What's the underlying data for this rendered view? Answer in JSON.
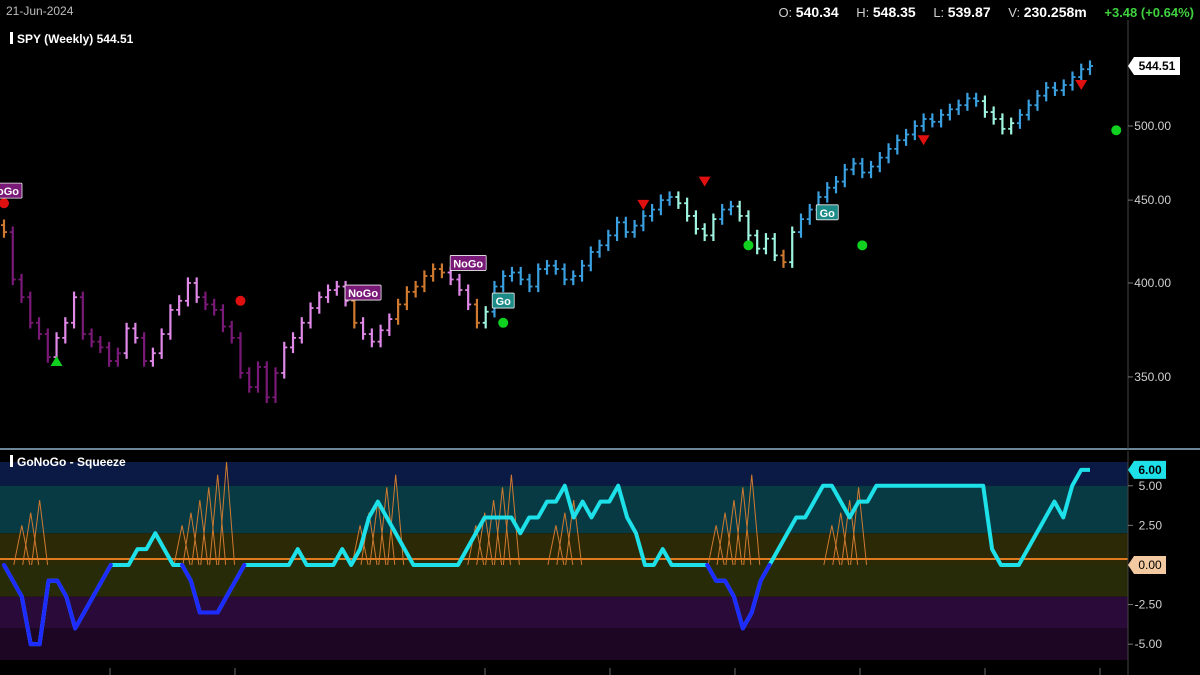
{
  "header": {
    "date": "21-Jun-2024",
    "open_label": "O:",
    "open": "540.34",
    "high_label": "H:",
    "high": "548.35",
    "low_label": "L:",
    "low": "539.87",
    "vol_label": "V:",
    "volume": "230.258m",
    "change": "+3.48 (+0.64%)"
  },
  "colors": {
    "background": "#000000",
    "go_strong": "#3aa0e0",
    "go_weak": "#9ff5e0",
    "nogo_strong": "#7a1a78",
    "nogo_weak": "#e089e8",
    "amber": "#d07a30",
    "oscillator_line": "#1de0e8",
    "squeeze_line": "#1e2bff",
    "zero_line": "#e07a20"
  },
  "chart_data": [
    {
      "type": "ohlc",
      "title": "SPY (Weekly) 544.51",
      "last_price_label": "544.51",
      "y_scale": "log",
      "ylim": [
        320,
        565
      ],
      "y_ticks": [
        "350.00",
        "400.00",
        "450.00",
        "500.00"
      ],
      "closes": [
        430,
        402,
        392,
        378,
        372,
        360,
        370,
        378,
        392,
        372,
        368,
        365,
        358,
        362,
        375,
        370,
        358,
        362,
        372,
        385,
        390,
        400,
        392,
        388,
        385,
        376,
        370,
        352,
        345,
        355,
        340,
        352,
        365,
        370,
        378,
        386,
        392,
        396,
        398,
        390,
        378,
        372,
        368,
        374,
        380,
        388,
        395,
        398,
        404,
        408,
        406,
        402,
        396,
        388,
        378,
        384,
        398,
        404,
        406,
        402,
        398,
        408,
        410,
        408,
        402,
        404,
        410,
        418,
        422,
        428,
        436,
        430,
        434,
        440,
        444,
        450,
        452,
        448,
        440,
        432,
        428,
        438,
        444,
        446,
        440,
        428,
        420,
        426,
        416,
        412,
        430,
        438,
        444,
        452,
        458,
        462,
        470,
        474,
        468,
        472,
        478,
        484,
        490,
        494,
        500,
        505,
        503,
        508,
        512,
        515,
        520,
        518,
        510,
        505,
        498,
        502,
        508,
        515,
        522,
        528,
        526,
        530,
        536,
        542,
        544.51
      ],
      "trend_colors": [
        "amber",
        "nogo_strong",
        "nogo_strong",
        "nogo_strong",
        "nogo_strong",
        "nogo_strong",
        "nogo_weak",
        "nogo_weak",
        "nogo_weak",
        "nogo_strong",
        "nogo_strong",
        "nogo_strong",
        "nogo_strong",
        "nogo_strong",
        "nogo_weak",
        "nogo_weak",
        "nogo_strong",
        "nogo_weak",
        "nogo_weak",
        "nogo_weak",
        "nogo_weak",
        "nogo_weak",
        "nogo_weak",
        "nogo_strong",
        "nogo_strong",
        "nogo_strong",
        "nogo_strong",
        "nogo_strong",
        "nogo_strong",
        "nogo_strong",
        "nogo_strong",
        "nogo_strong",
        "nogo_weak",
        "nogo_weak",
        "nogo_weak",
        "nogo_weak",
        "nogo_weak",
        "nogo_weak",
        "nogo_weak",
        "nogo_weak",
        "amber",
        "nogo_weak",
        "nogo_weak",
        "nogo_weak",
        "nogo_weak",
        "amber",
        "amber",
        "amber",
        "amber",
        "amber",
        "amber",
        "nogo_weak",
        "nogo_weak",
        "nogo_weak",
        "amber",
        "go_weak",
        "go_strong",
        "go_strong",
        "go_strong",
        "go_strong",
        "go_strong",
        "go_strong",
        "go_strong",
        "go_strong",
        "go_strong",
        "go_strong",
        "go_strong",
        "go_strong",
        "go_strong",
        "go_strong",
        "go_strong",
        "go_strong",
        "go_strong",
        "go_strong",
        "go_strong",
        "go_strong",
        "go_strong",
        "go_weak",
        "go_weak",
        "go_weak",
        "go_weak",
        "go_weak",
        "go_strong",
        "go_strong",
        "go_weak",
        "go_weak",
        "go_weak",
        "go_weak",
        "go_weak",
        "amber",
        "go_weak",
        "go_strong",
        "go_strong",
        "go_strong",
        "go_strong",
        "go_strong",
        "go_strong",
        "go_strong",
        "go_strong",
        "go_strong",
        "go_strong",
        "go_strong",
        "go_strong",
        "go_strong",
        "go_strong",
        "go_strong",
        "go_strong",
        "go_strong",
        "go_strong",
        "go_strong",
        "go_strong",
        "go_strong",
        "go_weak",
        "go_weak",
        "go_weak",
        "go_weak",
        "go_strong",
        "go_strong",
        "go_strong",
        "go_strong",
        "go_strong",
        "go_strong",
        "go_strong",
        "go_strong",
        "go_strong"
      ],
      "trend_labels": [
        {
          "bar": 0,
          "text": "NoGo",
          "kind": "nogo"
        },
        {
          "bar": 41,
          "text": "NoGo",
          "kind": "nogo"
        },
        {
          "bar": 53,
          "text": "NoGo",
          "kind": "nogo"
        },
        {
          "bar": 57,
          "text": "Go",
          "kind": "go"
        },
        {
          "bar": 94,
          "text": "Go",
          "kind": "go"
        }
      ],
      "markers": [
        {
          "bar": 0,
          "type": "dot",
          "color": "red",
          "value": 448
        },
        {
          "bar": 6,
          "type": "triangle-up",
          "color": "green",
          "value": 358
        },
        {
          "bar": 27,
          "type": "dot",
          "color": "red",
          "value": 390
        },
        {
          "bar": 57,
          "type": "dot",
          "color": "green",
          "value": 378
        },
        {
          "bar": 73,
          "type": "triangle-down",
          "color": "red",
          "value": 447
        },
        {
          "bar": 80,
          "type": "triangle-down",
          "color": "red",
          "value": 462
        },
        {
          "bar": 85,
          "type": "dot",
          "color": "green",
          "value": 422
        },
        {
          "bar": 98,
          "type": "dot",
          "color": "green",
          "value": 422
        },
        {
          "bar": 105,
          "type": "triangle-down",
          "color": "red",
          "value": 490
        },
        {
          "bar": 123,
          "type": "triangle-down",
          "color": "red",
          "value": 530
        },
        {
          "bar": 127,
          "type": "dot",
          "color": "green",
          "value": 497
        }
      ]
    },
    {
      "type": "line",
      "title": "GoNoGo - Squeeze",
      "value_label": "6.00",
      "zero_label": "0.00",
      "ylim": [
        -6,
        6.5
      ],
      "y_ticks": [
        "5.00",
        "2.50",
        "-2.50",
        "-5.00"
      ],
      "values": [
        0,
        -1,
        -2,
        -5,
        -5,
        -1,
        -1,
        -2,
        -4,
        -3,
        -2,
        -1,
        0,
        0,
        0,
        1,
        1,
        2,
        1,
        0,
        0,
        -1,
        -3,
        -3,
        -3,
        -2,
        -1,
        0,
        0,
        0,
        0,
        0,
        0,
        1,
        0,
        0,
        0,
        0,
        1,
        0,
        1,
        3,
        4,
        3,
        2,
        1,
        0,
        0,
        0,
        0,
        0,
        0,
        1,
        2,
        3,
        3,
        3,
        3,
        2,
        3,
        3,
        4,
        4,
        5,
        3,
        4,
        3,
        4,
        4,
        5,
        3,
        2,
        0,
        0,
        1,
        0,
        0,
        0,
        0,
        0,
        -1,
        -1,
        -2,
        -4,
        -3,
        -1,
        0,
        1,
        2,
        3,
        3,
        4,
        5,
        5,
        4,
        3,
        4,
        4,
        5,
        5,
        5,
        5,
        5,
        5,
        5,
        5,
        5,
        5,
        5,
        5,
        5,
        1,
        0,
        0,
        0,
        1,
        2,
        3,
        4,
        3,
        5,
        6,
        6
      ],
      "squeeze_sections": [
        [
          2,
          4
        ],
        [
          20,
          25
        ],
        [
          40,
          44
        ],
        [
          53,
          57
        ],
        [
          62,
          64
        ],
        [
          80,
          84
        ],
        [
          93,
          96
        ]
      ]
    }
  ]
}
